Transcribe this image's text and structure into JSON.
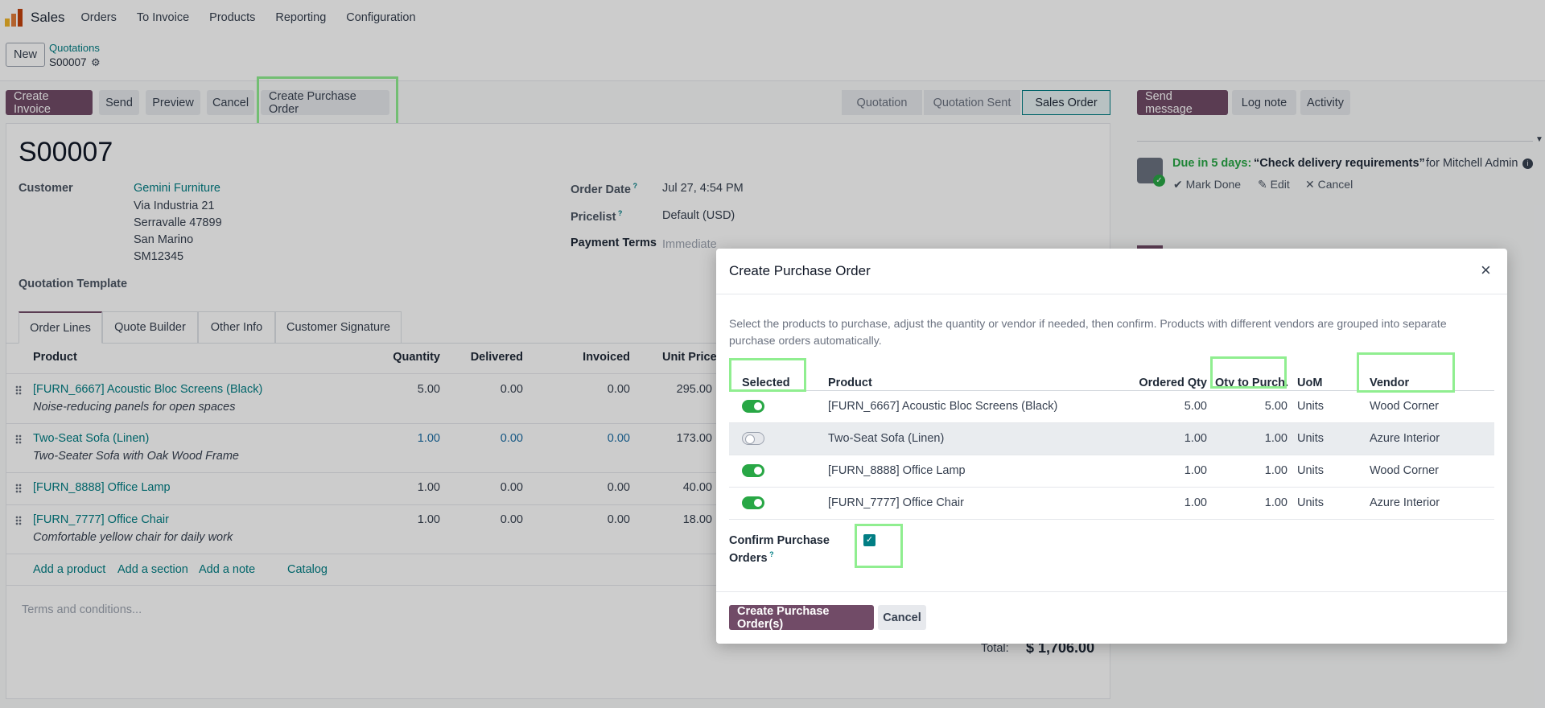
{
  "topnav": {
    "app": "Sales",
    "menus": [
      "Orders",
      "To Invoice",
      "Products",
      "Reporting",
      "Configuration"
    ]
  },
  "cpanel": {
    "new_label": "New",
    "breadcrumb": "Quotations",
    "record": "S00007"
  },
  "actions": {
    "create_invoice": "Create Invoice",
    "send": "Send",
    "preview": "Preview",
    "cancel": "Cancel",
    "create_po": "Create Purchase Order"
  },
  "stages": [
    "Quotation",
    "Quotation Sent",
    "Sales Order"
  ],
  "chatter": {
    "send_message": "Send message",
    "log_note": "Log note",
    "activity": "Activity",
    "due": "Due in 5 days:",
    "summary": "“Check delivery requirements”",
    "for": "for Mitchell Admin",
    "mark_done": "Mark Done",
    "edit": "Edit",
    "cancel": "Cancel"
  },
  "form": {
    "title": "S00007",
    "customer_label": "Customer",
    "customer_name": "Gemini Furniture",
    "address": [
      "Via Industria 21",
      "Serravalle 47899",
      "San Marino",
      "SM12345"
    ],
    "order_date_label": "Order Date",
    "order_date": "Jul 27, 4:54 PM",
    "pricelist_label": "Pricelist",
    "pricelist": "Default (USD)",
    "payment_terms_label": "Payment Terms",
    "payment_terms": "Immediate",
    "quotation_template_label": "Quotation Template",
    "tabs": [
      "Order Lines",
      "Quote Builder",
      "Other Info",
      "Customer Signature"
    ],
    "columns": [
      "Product",
      "Quantity",
      "Delivered",
      "Invoiced",
      "Unit Price"
    ],
    "lines": [
      {
        "product": "[FURN_6667] Acoustic Bloc Screens (Black)",
        "desc": "Noise-reducing panels for open spaces",
        "qty": "5.00",
        "delivered": "0.00",
        "invoiced": "0.00",
        "price": "295.00"
      },
      {
        "product": "Two-Seat Sofa (Linen)",
        "desc": "Two-Seater Sofa with Oak Wood Frame",
        "qty": "1.00",
        "delivered": "0.00",
        "invoiced": "0.00",
        "price": "173.00"
      },
      {
        "product": "[FURN_8888] Office Lamp",
        "desc": "",
        "qty": "1.00",
        "delivered": "0.00",
        "invoiced": "0.00",
        "price": "40.00"
      },
      {
        "product": "[FURN_7777] Office Chair",
        "desc": "Comfortable yellow chair for daily work",
        "qty": "1.00",
        "delivered": "0.00",
        "invoiced": "0.00",
        "price": "18.00"
      }
    ],
    "add_product": "Add a product",
    "add_section": "Add a section",
    "add_note": "Add a note",
    "catalog": "Catalog",
    "terms_placeholder": "Terms and conditions...",
    "total_label": "Total:",
    "total": "$ 1,706.00"
  },
  "modal": {
    "title": "Create Purchase Order",
    "intro": "Select the products to purchase, adjust the quantity or vendor if needed, then confirm. Products with different vendors are grouped into separate purchase orders automatically.",
    "columns": [
      "Selected",
      "Product",
      "Ordered Qty",
      "Qty to Purch...",
      "UoM",
      "Vendor"
    ],
    "rows": [
      {
        "selected": true,
        "product": "[FURN_6667] Acoustic Bloc Screens (Black)",
        "ordered": "5.00",
        "to_purchase": "5.00",
        "uom": "Units",
        "vendor": "Wood Corner"
      },
      {
        "selected": false,
        "product": "Two-Seat Sofa (Linen)",
        "ordered": "1.00",
        "to_purchase": "1.00",
        "uom": "Units",
        "vendor": "Azure Interior"
      },
      {
        "selected": true,
        "product": "[FURN_8888] Office Lamp",
        "ordered": "1.00",
        "to_purchase": "1.00",
        "uom": "Units",
        "vendor": "Wood Corner"
      },
      {
        "selected": true,
        "product": "[FURN_7777] Office Chair",
        "ordered": "1.00",
        "to_purchase": "1.00",
        "uom": "Units",
        "vendor": "Azure Interior"
      }
    ],
    "confirm_label_1": "Confirm Purchase",
    "confirm_label_2": "Orders",
    "confirm_checked": true,
    "create_btn": "Create Purchase Order(s)",
    "cancel_btn": "Cancel"
  },
  "colors": {
    "primary": "#714b67",
    "link": "#017e84",
    "success": "#28a745",
    "highlight": "#90ee90"
  }
}
